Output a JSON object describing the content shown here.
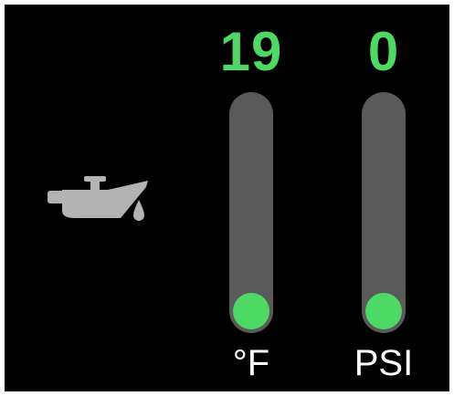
{
  "colors": {
    "background": "#000000",
    "value_text": "#4cd964",
    "track": "#5a5a5a",
    "indicator": "#4cd964",
    "icon": "#b3b3b3",
    "unit_text": "#ffffff"
  },
  "icon": "oil-can-icon",
  "gauges": [
    {
      "value": "19",
      "unit": "°F",
      "level": 0
    },
    {
      "value": "0",
      "unit": "PSI",
      "level": 0
    }
  ]
}
